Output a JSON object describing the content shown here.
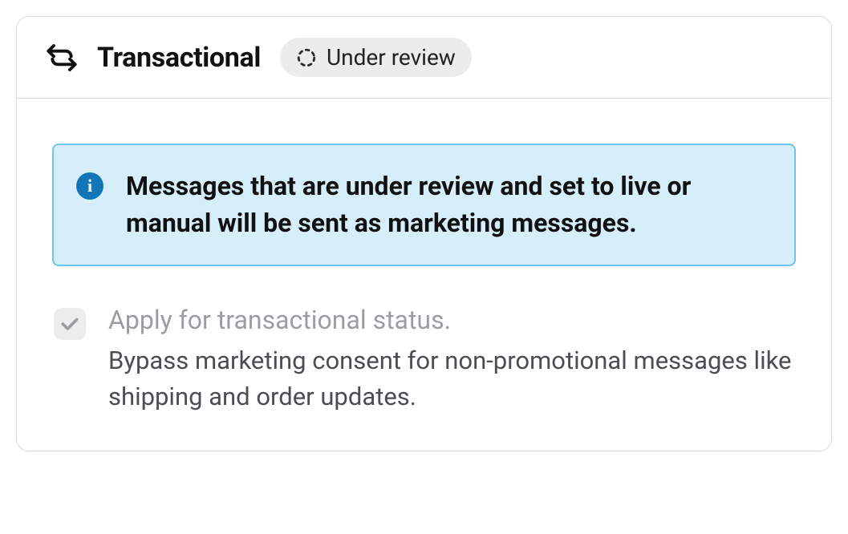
{
  "header": {
    "icon": "transactional-icon",
    "title": "Transactional",
    "status": {
      "icon": "dashed-circle-icon",
      "label": "Under review"
    }
  },
  "banner": {
    "icon_symbol": "i",
    "message": "Messages that are under review and set to live or manual will be sent as marketing messages."
  },
  "option": {
    "checked": true,
    "disabled": true,
    "label": "Apply for transactional status.",
    "helper": "Bypass marketing consent for non-promotional messages like shipping and order updates."
  }
}
